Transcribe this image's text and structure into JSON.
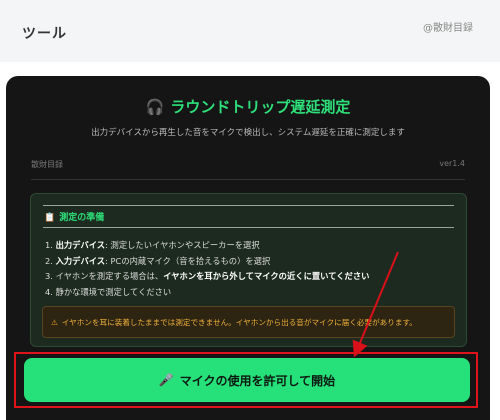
{
  "header": {
    "title": "ツール",
    "credit": "@散財目録"
  },
  "card": {
    "heading_icon": "headphones-icon",
    "heading_icon_glyph": "🎧",
    "heading": "ラウンドトリップ遅延測定",
    "subtitle": "出力デバイスから再生した音をマイクで検出し、システム遅延を正確に測定します",
    "meta_left": "散財目録",
    "meta_right": "ver1.4"
  },
  "prep": {
    "icon_glyph": "📋",
    "title": "測定の準備",
    "steps": [
      {
        "num": "1.",
        "bold": "出力デバイス",
        "rest": ": 測定したいイヤホンやスピーカーを選択"
      },
      {
        "num": "2.",
        "bold": "入力デバイス",
        "rest": ": PCの内蔵マイク（音を拾えるもの）を選択"
      },
      {
        "num": "3.",
        "pre": "イヤホンを測定する場合は、",
        "bold": "イヤホンを耳から外してマイクの近くに置いてください"
      },
      {
        "num": "4.",
        "text": "静かな環境で測定してください"
      }
    ],
    "warning_glyph": "⚠",
    "warning": "イヤホンを耳に装着したままでは測定できません。イヤホンから出る音がマイクに届く必要があります。"
  },
  "button": {
    "icon_glyph": "🎤",
    "label": "マイクの使用を許可して開始"
  },
  "colors": {
    "accent": "#2ee07a",
    "button": "#26e07a",
    "card_bg": "#151515",
    "highlight": "#e0121b",
    "warning": "#f0b23a"
  }
}
